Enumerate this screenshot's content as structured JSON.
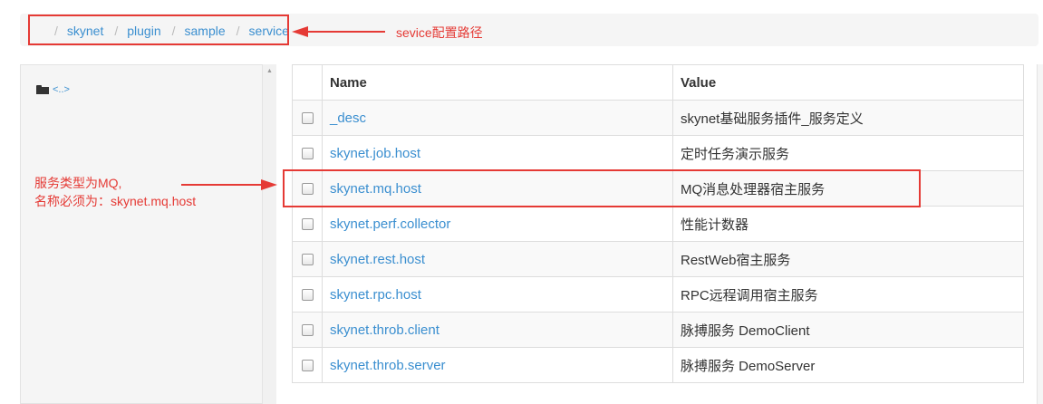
{
  "breadcrumb": {
    "items": [
      "skynet",
      "plugin",
      "sample",
      "service"
    ],
    "separator": "/"
  },
  "sidebar": {
    "parent_link": "<..>"
  },
  "table": {
    "headers": [
      "Name",
      "Value"
    ],
    "rows": [
      {
        "name": "_desc",
        "value": "skynet基础服务插件_服务定义"
      },
      {
        "name": "skynet.job.host",
        "value": "定时任务演示服务"
      },
      {
        "name": "skynet.mq.host",
        "value": "MQ消息处理器宿主服务"
      },
      {
        "name": "skynet.perf.collector",
        "value": "性能计数器"
      },
      {
        "name": "skynet.rest.host",
        "value": "RestWeb宿主服务"
      },
      {
        "name": "skynet.rpc.host",
        "value": "RPC远程调用宿主服务"
      },
      {
        "name": "skynet.throb.client",
        "value": "脉搏服务 DemoClient"
      },
      {
        "name": "skynet.throb.server",
        "value": "脉搏服务 DemoServer"
      }
    ]
  },
  "annotations": {
    "path_note": "sevice配置路径",
    "name_note_line1": "服务类型为MQ,",
    "name_note_line2": "名称必须为：skynet.mq.host"
  },
  "colors": {
    "link": "#3b8fd0",
    "annotation": "#e53a35",
    "panel_bg": "#f5f5f5"
  }
}
